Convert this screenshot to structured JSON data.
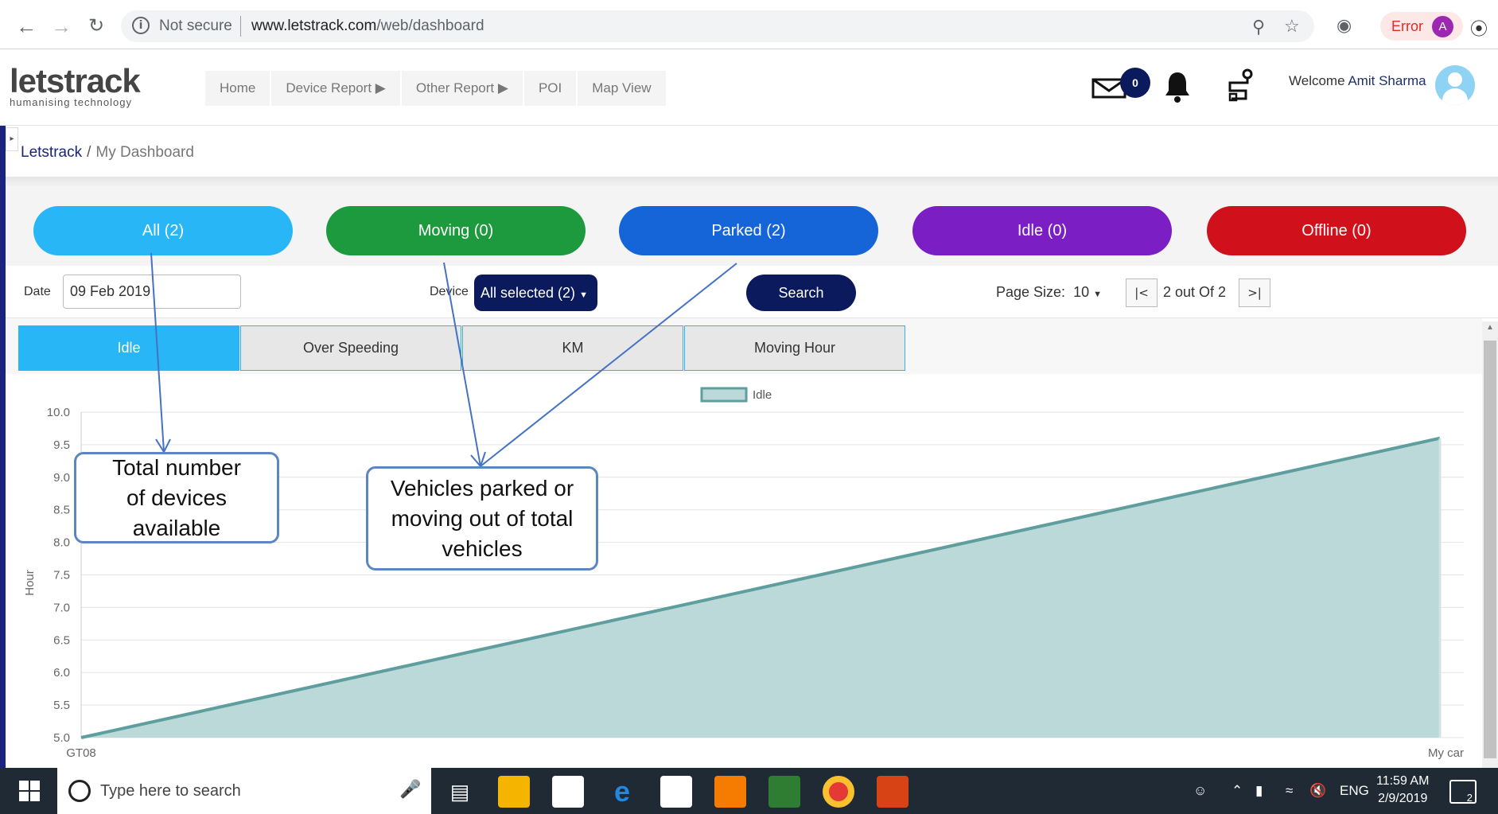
{
  "browser": {
    "security_label": "Not secure",
    "url_host": "www.letstrack.com",
    "url_path": "/web/dashboard",
    "error_label": "Error",
    "profile_initial": "A"
  },
  "header": {
    "brand": "letstrack",
    "tagline": "humanising technology",
    "nav": [
      "Home",
      "Device Report ▶",
      "Other Report ▶",
      "POI",
      "Map View"
    ],
    "mail_count": "0",
    "welcome_prefix": "Welcome",
    "user_name": "Amit Sharma"
  },
  "breadcrumb": {
    "root": "Letstrack",
    "separator": "/",
    "current": "My Dashboard"
  },
  "status_pills": [
    {
      "label": "All (2)",
      "color": "#29b6f6"
    },
    {
      "label": "Moving (0)",
      "color": "#1e9a3e"
    },
    {
      "label": "Parked (2)",
      "color": "#1565d8"
    },
    {
      "label": "Idle (0)",
      "color": "#7b1fc4"
    },
    {
      "label": "Offline (0)",
      "color": "#d0111b"
    }
  ],
  "filters": {
    "date_label": "Date",
    "date_value": "09 Feb 2019",
    "device_label": "Device",
    "device_value": "All selected (2)",
    "search_label": "Search",
    "page_size_label": "Page Size:",
    "page_size_value": "10",
    "first_label": "|<",
    "last_label": ">|",
    "page_info": "2 out Of 2"
  },
  "tabs": [
    "Idle",
    "Over Speeding",
    "KM",
    "Moving Hour"
  ],
  "chart_data": {
    "type": "area",
    "title": "",
    "xlabel": "",
    "ylabel": "Hour",
    "categories": [
      "GT08",
      "My car"
    ],
    "series": [
      {
        "name": "Idle",
        "values": [
          5.0,
          9.6
        ]
      }
    ],
    "ylim": [
      5.0,
      10.0
    ],
    "yticks": [
      "10.0",
      "9.5",
      "9.0",
      "8.5",
      "8.0",
      "7.5",
      "7.0",
      "6.5",
      "6.0",
      "5.5",
      "5.0"
    ],
    "grid": true,
    "legend": "top-center",
    "fill_color": "#bcd9d9",
    "line_color": "#5e9e9e"
  },
  "callouts": {
    "total_devices": "Total number of devices available",
    "parked_moving": "Vehicles parked or moving out of total vehicles"
  },
  "taskbar": {
    "search_placeholder": "Type here to search",
    "lang": "ENG",
    "time": "11:59 AM",
    "date": "2/9/2019",
    "notification_count": "2"
  }
}
